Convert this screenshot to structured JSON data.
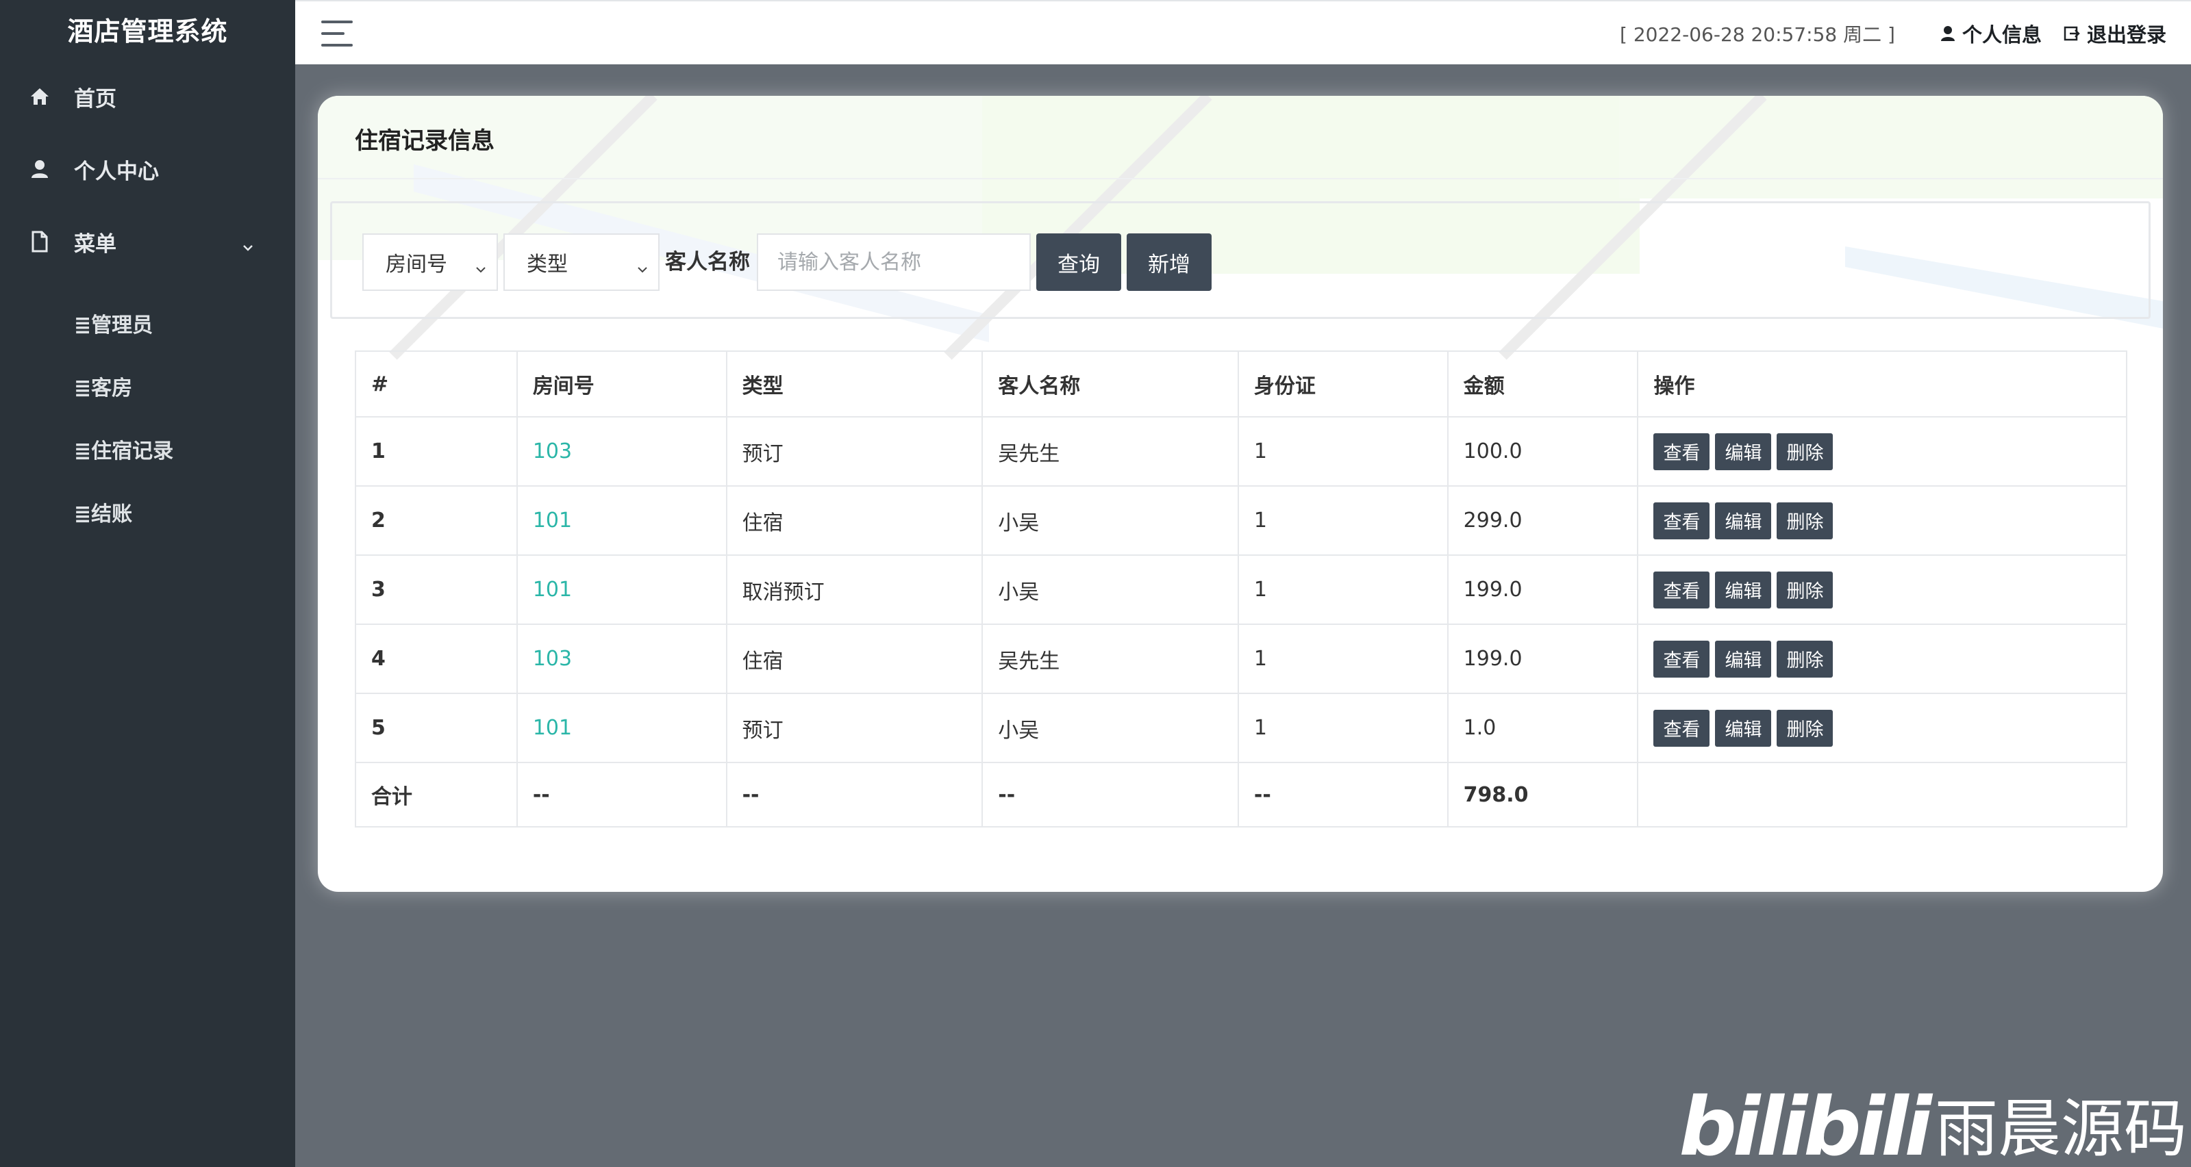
{
  "app": {
    "title": "酒店管理系统"
  },
  "sidebar": {
    "items": [
      {
        "label": "首页",
        "icon": "home-icon"
      },
      {
        "label": "个人中心",
        "icon": "user-icon"
      },
      {
        "label": "菜单",
        "icon": "file-icon"
      }
    ],
    "submenu": [
      {
        "label": "≣管理员"
      },
      {
        "label": "≣客房"
      },
      {
        "label": "≣住宿记录"
      },
      {
        "label": "≣结账"
      }
    ]
  },
  "topbar": {
    "datetime": "[ 2022-06-28 20:57:58 周二 ]",
    "profile_label": "个人信息",
    "logout_label": "退出登录"
  },
  "page": {
    "title": "住宿记录信息",
    "search": {
      "room_select": "房间号",
      "type_select": "类型",
      "name_label": "客人名称",
      "name_placeholder": "请输入客人名称",
      "query_label": "查询",
      "add_label": "新增"
    },
    "table": {
      "headers": [
        "#",
        "房间号",
        "类型",
        "客人名称",
        "身份证",
        "金额",
        "操作"
      ],
      "rows": [
        {
          "id": "1",
          "room": "103",
          "type": "预订",
          "guest": "吴先生",
          "id_card": "1",
          "amount": "100.0"
        },
        {
          "id": "2",
          "room": "101",
          "type": "住宿",
          "guest": "小吴",
          "id_card": "1",
          "amount": "299.0"
        },
        {
          "id": "3",
          "room": "101",
          "type": "取消预订",
          "guest": "小吴",
          "id_card": "1",
          "amount": "199.0"
        },
        {
          "id": "4",
          "room": "103",
          "type": "住宿",
          "guest": "吴先生",
          "id_card": "1",
          "amount": "199.0"
        },
        {
          "id": "5",
          "room": "101",
          "type": "预订",
          "guest": "小吴",
          "id_card": "1",
          "amount": "1.0"
        }
      ],
      "actions": {
        "view": "查看",
        "edit": "编辑",
        "delete": "删除"
      },
      "total": {
        "label": "合计",
        "room": "--",
        "type": "--",
        "guest": "--",
        "id_card": "--",
        "amount": "798.0"
      }
    }
  },
  "watermark": {
    "logo": "bilibili",
    "text": "雨晨源码"
  },
  "colors": {
    "sidebar": "#2a3239",
    "background": "#646b73",
    "button": "#3f4a57",
    "link": "#2bb6a8"
  }
}
